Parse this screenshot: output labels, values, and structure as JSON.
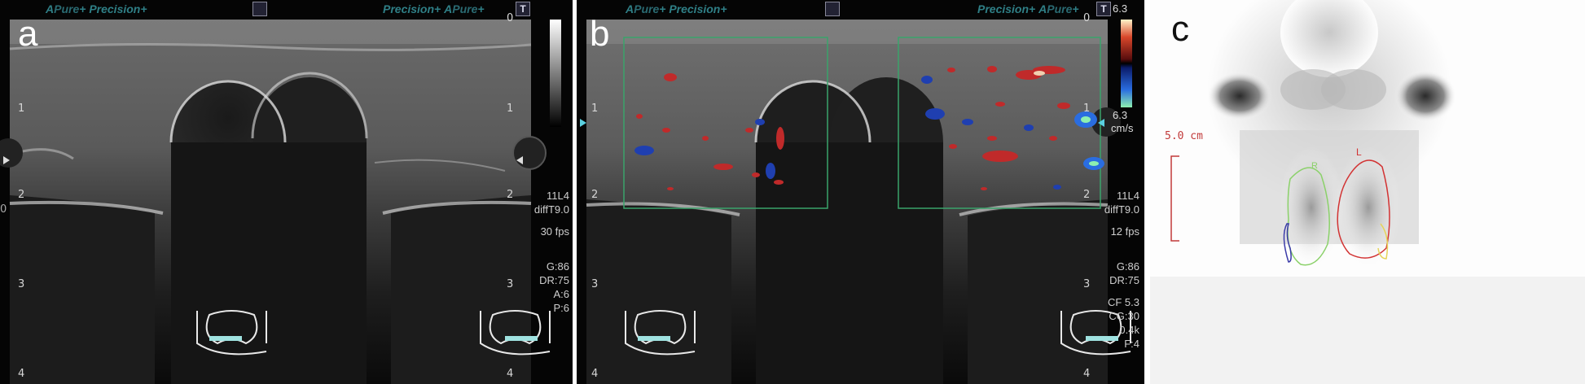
{
  "panels": {
    "a": {
      "letter": "a",
      "hdr_left": [
        "A",
        "Pure",
        "+",
        "Precision",
        "+"
      ],
      "hdr_right": [
        "Precision",
        "+",
        "A",
        "Pure",
        "+"
      ],
      "top_zero": "0",
      "depth_labels": [
        "1",
        "2",
        "3",
        "4"
      ],
      "right_depth_labels": [
        "1",
        "2",
        "3",
        "4"
      ],
      "side_text": [
        "11L4",
        "diffT9.0",
        "30 fps",
        "",
        "G:86",
        "DR:75",
        "A:6",
        "P:6"
      ],
      "left_zero": "0",
      "t_mark": "T"
    },
    "b": {
      "letter": "b",
      "hdr_left": [
        "A",
        "Pure",
        "+",
        "Precision",
        "+"
      ],
      "hdr_right": [
        "Precision",
        "+",
        "A",
        "Pure",
        "+"
      ],
      "top_zero": "0",
      "depth_labels": [
        "1",
        "2",
        "3",
        "4"
      ],
      "right_depth_labels": [
        "1",
        "2",
        "3",
        "4"
      ],
      "side_text": [
        "11L4",
        "diffT9.0",
        "12 fps",
        "",
        "G:86",
        "DR:75",
        "",
        "CF 5.3",
        "CG:30",
        "0.4k",
        "F:4"
      ],
      "t_mark": "T",
      "color_scale_top": "6.3",
      "color_scale_bottom": "6.3",
      "color_scale_unit": "cm/s"
    },
    "c": {
      "letter": "c",
      "scale_label": "5.0 cm",
      "roi_left_label": "R",
      "roi_right_label": "L"
    }
  },
  "colors": {
    "ultrasound_bg": "#050505",
    "letter_dark": "#111111",
    "letter_light": "#ffffff",
    "doppler_box": "#3aa36b",
    "scale_red": "#c23a3a",
    "roi_green": "#8bd16a",
    "roi_red": "#d23333",
    "roi_blue": "#3a3aa8",
    "roi_yellow": "#e6d45a"
  }
}
